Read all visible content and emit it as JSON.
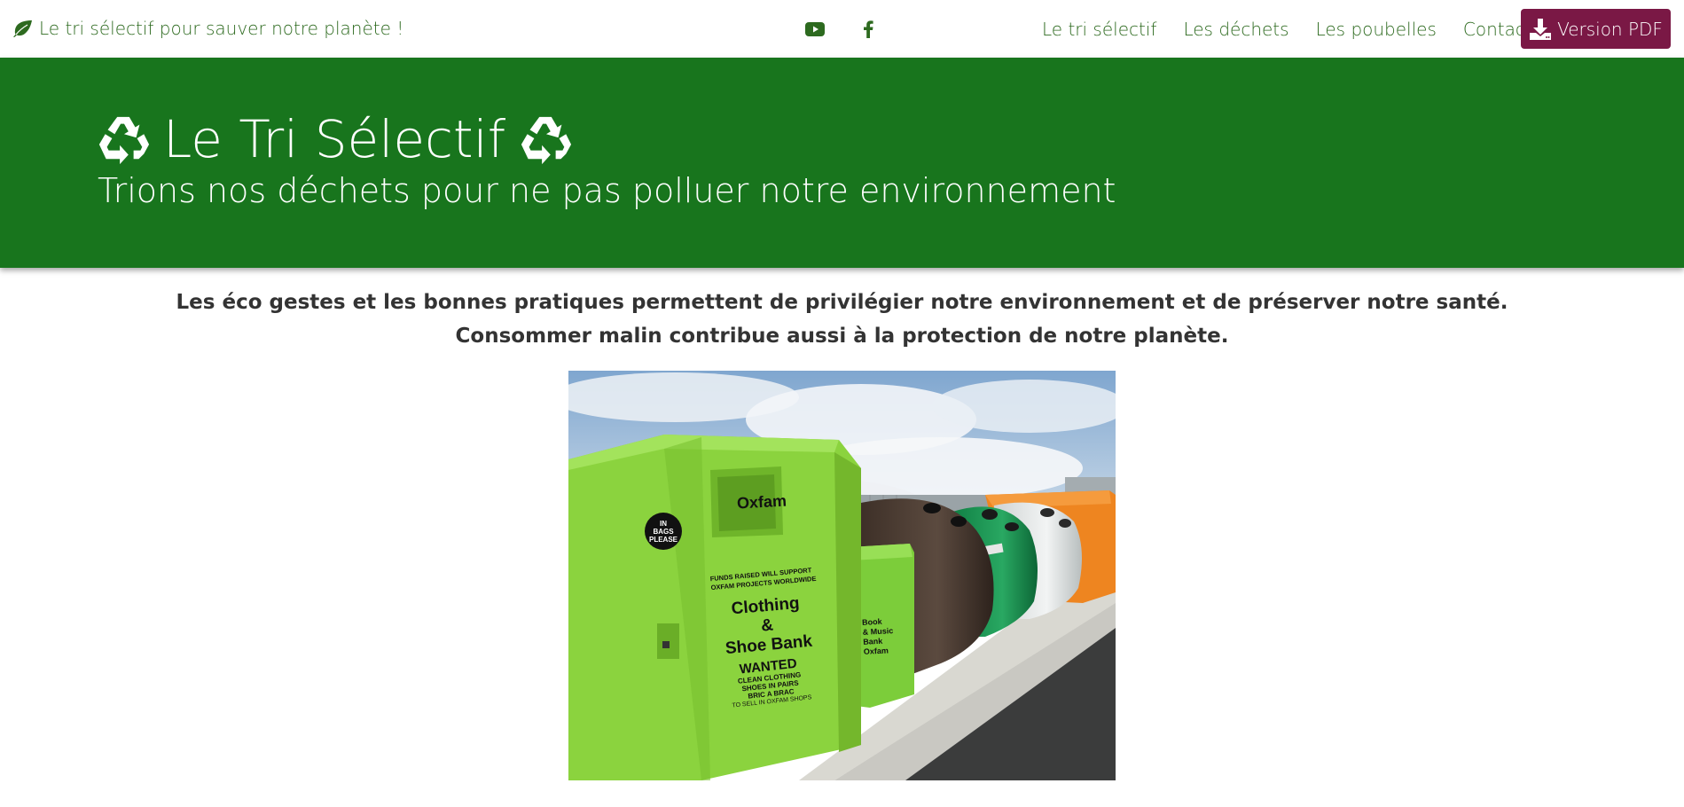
{
  "navbar": {
    "brand_text": "Le tri sélectif pour sauver notre planète !",
    "brand_icon": "leaf-icon",
    "social": [
      {
        "name": "youtube-icon"
      },
      {
        "name": "facebook-icon"
      }
    ],
    "links": [
      {
        "label": "Le tri sélectif"
      },
      {
        "label": "Les déchets"
      },
      {
        "label": "Les poubelles"
      },
      {
        "label": "Contact"
      }
    ],
    "pdf_button": "Version PDF",
    "pdf_icon": "download-icon"
  },
  "hero": {
    "title": "Le Tri Sélectif",
    "title_icon": "recycle-icon",
    "subtitle": "Trions nos déchets pour ne pas polluer notre environnement"
  },
  "intro": {
    "line1": "Les éco gestes et les bonnes pratiques permettent de privilégier notre environnement et de préserver notre santé.",
    "line2": "Consommer malin contribue aussi à la protection de notre planète."
  },
  "photo": {
    "bank_brand": "Oxfam",
    "in_bags": [
      "IN",
      "BAGS",
      "PLEASE"
    ],
    "funds_text": [
      "FUNDS RAISED WILL SUPPORT",
      "OXFAM PROJECTS WORLDWIDE"
    ],
    "bank_title": [
      "Clothing",
      "&",
      "Shoe Bank"
    ],
    "wanted": "WANTED",
    "wanted_lines": [
      "CLEAN CLOTHING",
      "SHOES IN PAIRS",
      "BRIC A BRAC",
      "TO SELL IN OXFAM SHOPS"
    ],
    "book_bank": [
      "Book",
      "& Music",
      "Bank"
    ],
    "book_brand": "Oxfam"
  },
  "colors": {
    "nav_text": "#2d6a1f",
    "hero_bg": "#18751d",
    "pdf_bg": "#7a1845"
  }
}
